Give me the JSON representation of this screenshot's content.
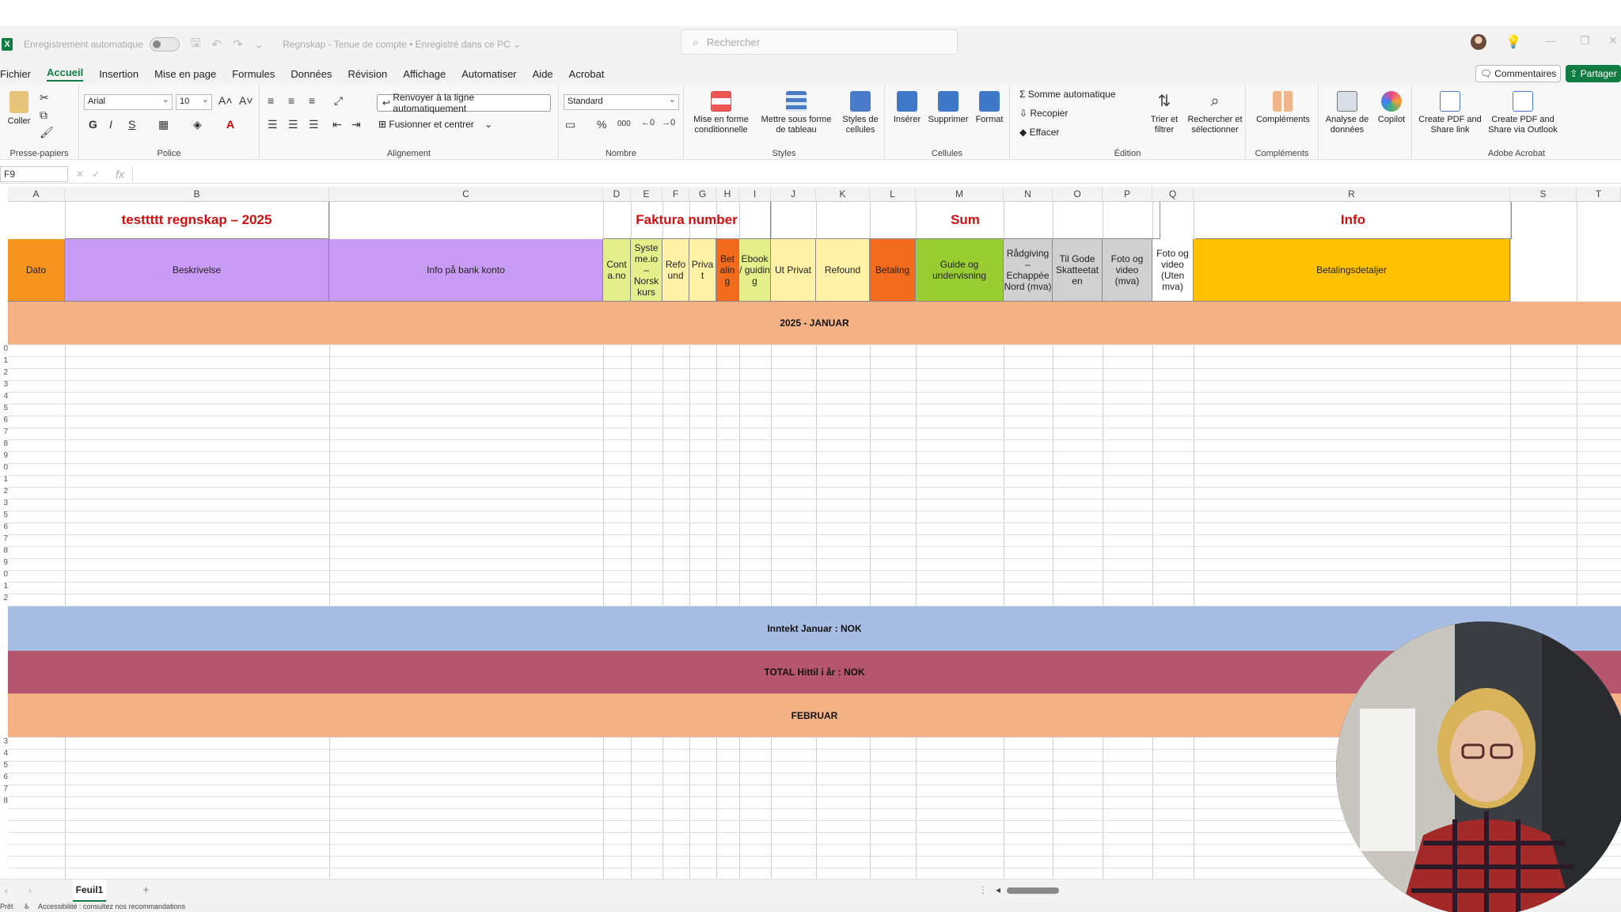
{
  "window": {
    "autosave_label": "Enregistrement automatique",
    "doc_title": "Regnskap - Tenue de compte • Enregistré dans ce PC ⌄",
    "search_placeholder": "Rechercher"
  },
  "menu": {
    "items": [
      "Fichier",
      "Accueil",
      "Insertion",
      "Mise en page",
      "Formules",
      "Données",
      "Révision",
      "Affichage",
      "Automatiser",
      "Aide",
      "Acrobat"
    ],
    "active": "Accueil",
    "comments": "Commentaires",
    "share": "Partager"
  },
  "ribbon": {
    "paste": "Coller",
    "clipboard": "Presse-papiers",
    "font_name": "Arial",
    "font_size": "10",
    "bold": "G",
    "italic": "I",
    "underline": "S",
    "font": "Police",
    "wrap": "Renvoyer à la ligne automatiquement",
    "merge": "Fusionner et centrer",
    "alignment": "Alignement",
    "number_format": "Standard",
    "number": "Nombre",
    "cond_format": "Mise en forme conditionnelle",
    "as_table": "Mettre sous forme de tableau",
    "cell_styles": "Styles de cellules",
    "styles": "Styles",
    "insert": "Insérer",
    "delete": "Supprimer",
    "format": "Format",
    "cells": "Cellules",
    "autosum": "Somme automatique",
    "fill": "Recopier",
    "clear": "Effacer",
    "sort": "Trier et filtrer",
    "find": "Rechercher et sélectionner",
    "editing": "Édition",
    "addins": "Compléments",
    "addins_group": "Compléments",
    "analyze": "Analyse de données",
    "copilot": "Copilot",
    "pdf_share": "Create PDF and Share link",
    "pdf_outlook": "Create PDF and Share via Outlook",
    "acrobat": "Adobe Acrobat"
  },
  "formula_bar": {
    "name_box": "F9",
    "fx": "fx"
  },
  "columns": [
    "A",
    "B",
    "C",
    "D",
    "E",
    "F",
    "G",
    "H",
    "I",
    "J",
    "K",
    "L",
    "M",
    "N",
    "O",
    "P",
    "Q",
    "R",
    "S",
    "T"
  ],
  "sheet": {
    "title_B": "testtttt  regnskap – 2025",
    "title_faktura": "Faktura number",
    "title_sum": "Sum",
    "title_info": "Info",
    "headers": {
      "A": "Dato",
      "B": "Beskrivelse",
      "C": "Info på bank konto",
      "D": "Cont a.no",
      "E": "Syste me.io – Norsk kurs",
      "F": "Refo und",
      "G": "Priva t",
      "H": "Bet alin g",
      "I": "Ebook / guidin g",
      "J": "Ut Privat",
      "K": "Refound",
      "L": "Betaling",
      "M": "Guide og undervisning",
      "N": "Rådgiving – Echappée Nord (mva)",
      "O": "Til Gode Skatteetat en",
      "P": "Foto og video (mva)",
      "Q": "Foto og video (Uten mva)",
      "R": "Betalingsdetaljer"
    },
    "band_jan": "2025 - JANUAR",
    "band_income": "Inntekt Januar :   NOK",
    "band_total": "TOTAL Hittil i år :  NOK",
    "band_feb": "FEBRUAR",
    "row_labels_left": [
      "0",
      "1",
      "2",
      "3",
      "4",
      "5",
      "6",
      "7",
      "8",
      "9",
      "0",
      "1",
      "2",
      "3",
      "5",
      "6",
      "7",
      "8",
      "9",
      "0",
      "1",
      "2",
      "3",
      "4",
      "5",
      "6",
      "7",
      "8"
    ]
  },
  "tabs": {
    "sheet1": "Feuil1",
    "add": "+"
  },
  "status": {
    "accessibility": "Accessibilité : consultez nos recommandations",
    "ready": "Prêt"
  },
  "colors": {
    "orange": "#f7941d",
    "purple": "#c89bf5",
    "lightyellow": "#fff2a6",
    "yellowgreen": "#e4ee8a",
    "deeporange": "#f36b1c",
    "green": "#9acd32",
    "grey": "#d0d0d0",
    "gold": "#ffc000",
    "peach": "#f4b183",
    "blue": "#a7bde3",
    "rose": "#b5566e",
    "red": "#e00000",
    "excel_green": "#107c41"
  }
}
